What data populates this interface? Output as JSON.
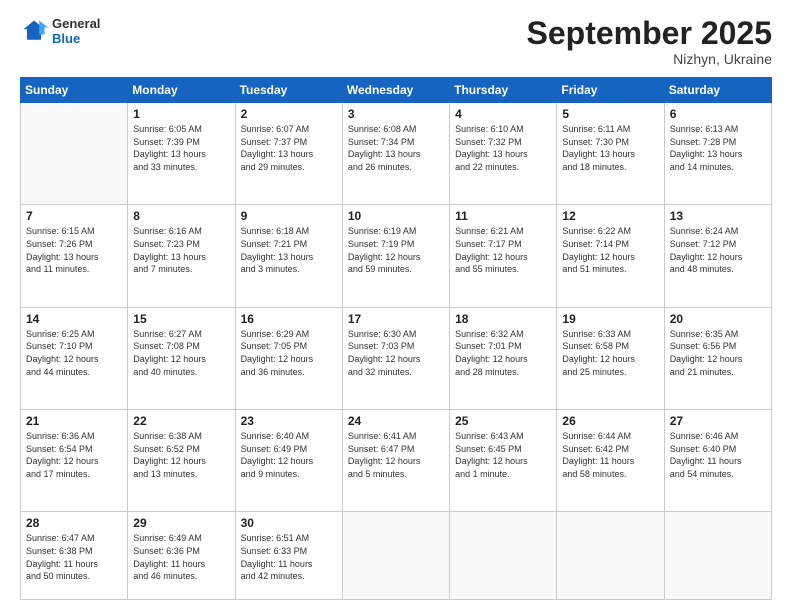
{
  "header": {
    "logo_general": "General",
    "logo_blue": "Blue",
    "month_title": "September 2025",
    "location": "Nizhyn, Ukraine"
  },
  "weekdays": [
    "Sunday",
    "Monday",
    "Tuesday",
    "Wednesday",
    "Thursday",
    "Friday",
    "Saturday"
  ],
  "weeks": [
    [
      {
        "day": "",
        "info": ""
      },
      {
        "day": "1",
        "info": "Sunrise: 6:05 AM\nSunset: 7:39 PM\nDaylight: 13 hours\nand 33 minutes."
      },
      {
        "day": "2",
        "info": "Sunrise: 6:07 AM\nSunset: 7:37 PM\nDaylight: 13 hours\nand 29 minutes."
      },
      {
        "day": "3",
        "info": "Sunrise: 6:08 AM\nSunset: 7:34 PM\nDaylight: 13 hours\nand 26 minutes."
      },
      {
        "day": "4",
        "info": "Sunrise: 6:10 AM\nSunset: 7:32 PM\nDaylight: 13 hours\nand 22 minutes."
      },
      {
        "day": "5",
        "info": "Sunrise: 6:11 AM\nSunset: 7:30 PM\nDaylight: 13 hours\nand 18 minutes."
      },
      {
        "day": "6",
        "info": "Sunrise: 6:13 AM\nSunset: 7:28 PM\nDaylight: 13 hours\nand 14 minutes."
      }
    ],
    [
      {
        "day": "7",
        "info": "Sunrise: 6:15 AM\nSunset: 7:26 PM\nDaylight: 13 hours\nand 11 minutes."
      },
      {
        "day": "8",
        "info": "Sunrise: 6:16 AM\nSunset: 7:23 PM\nDaylight: 13 hours\nand 7 minutes."
      },
      {
        "day": "9",
        "info": "Sunrise: 6:18 AM\nSunset: 7:21 PM\nDaylight: 13 hours\nand 3 minutes."
      },
      {
        "day": "10",
        "info": "Sunrise: 6:19 AM\nSunset: 7:19 PM\nDaylight: 12 hours\nand 59 minutes."
      },
      {
        "day": "11",
        "info": "Sunrise: 6:21 AM\nSunset: 7:17 PM\nDaylight: 12 hours\nand 55 minutes."
      },
      {
        "day": "12",
        "info": "Sunrise: 6:22 AM\nSunset: 7:14 PM\nDaylight: 12 hours\nand 51 minutes."
      },
      {
        "day": "13",
        "info": "Sunrise: 6:24 AM\nSunset: 7:12 PM\nDaylight: 12 hours\nand 48 minutes."
      }
    ],
    [
      {
        "day": "14",
        "info": "Sunrise: 6:25 AM\nSunset: 7:10 PM\nDaylight: 12 hours\nand 44 minutes."
      },
      {
        "day": "15",
        "info": "Sunrise: 6:27 AM\nSunset: 7:08 PM\nDaylight: 12 hours\nand 40 minutes."
      },
      {
        "day": "16",
        "info": "Sunrise: 6:29 AM\nSunset: 7:05 PM\nDaylight: 12 hours\nand 36 minutes."
      },
      {
        "day": "17",
        "info": "Sunrise: 6:30 AM\nSunset: 7:03 PM\nDaylight: 12 hours\nand 32 minutes."
      },
      {
        "day": "18",
        "info": "Sunrise: 6:32 AM\nSunset: 7:01 PM\nDaylight: 12 hours\nand 28 minutes."
      },
      {
        "day": "19",
        "info": "Sunrise: 6:33 AM\nSunset: 6:58 PM\nDaylight: 12 hours\nand 25 minutes."
      },
      {
        "day": "20",
        "info": "Sunrise: 6:35 AM\nSunset: 6:56 PM\nDaylight: 12 hours\nand 21 minutes."
      }
    ],
    [
      {
        "day": "21",
        "info": "Sunrise: 6:36 AM\nSunset: 6:54 PM\nDaylight: 12 hours\nand 17 minutes."
      },
      {
        "day": "22",
        "info": "Sunrise: 6:38 AM\nSunset: 6:52 PM\nDaylight: 12 hours\nand 13 minutes."
      },
      {
        "day": "23",
        "info": "Sunrise: 6:40 AM\nSunset: 6:49 PM\nDaylight: 12 hours\nand 9 minutes."
      },
      {
        "day": "24",
        "info": "Sunrise: 6:41 AM\nSunset: 6:47 PM\nDaylight: 12 hours\nand 5 minutes."
      },
      {
        "day": "25",
        "info": "Sunrise: 6:43 AM\nSunset: 6:45 PM\nDaylight: 12 hours\nand 1 minute."
      },
      {
        "day": "26",
        "info": "Sunrise: 6:44 AM\nSunset: 6:42 PM\nDaylight: 11 hours\nand 58 minutes."
      },
      {
        "day": "27",
        "info": "Sunrise: 6:46 AM\nSunset: 6:40 PM\nDaylight: 11 hours\nand 54 minutes."
      }
    ],
    [
      {
        "day": "28",
        "info": "Sunrise: 6:47 AM\nSunset: 6:38 PM\nDaylight: 11 hours\nand 50 minutes."
      },
      {
        "day": "29",
        "info": "Sunrise: 6:49 AM\nSunset: 6:36 PM\nDaylight: 11 hours\nand 46 minutes."
      },
      {
        "day": "30",
        "info": "Sunrise: 6:51 AM\nSunset: 6:33 PM\nDaylight: 11 hours\nand 42 minutes."
      },
      {
        "day": "",
        "info": ""
      },
      {
        "day": "",
        "info": ""
      },
      {
        "day": "",
        "info": ""
      },
      {
        "day": "",
        "info": ""
      }
    ]
  ]
}
